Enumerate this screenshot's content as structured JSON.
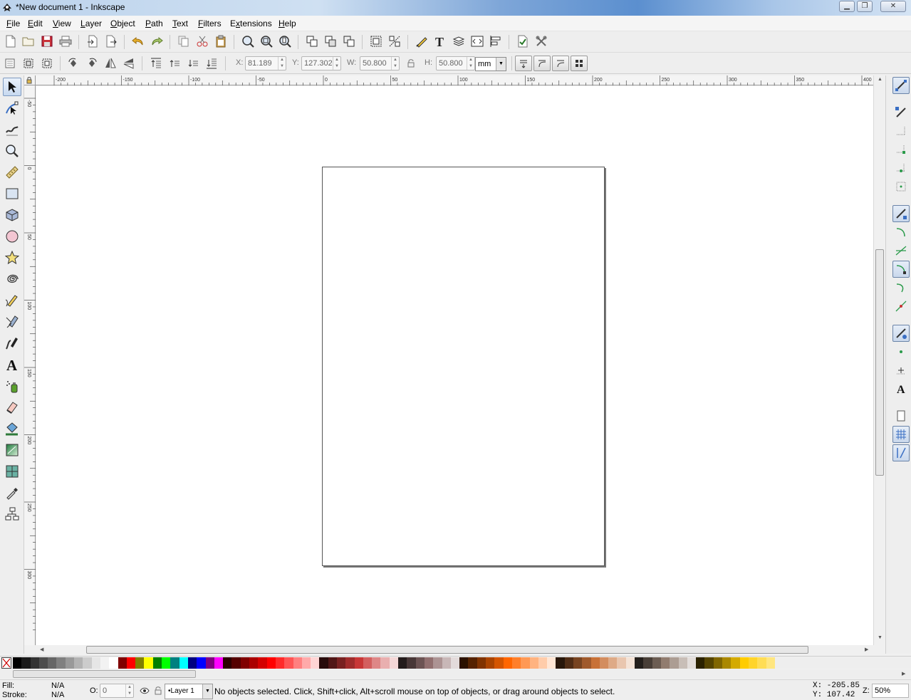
{
  "window": {
    "title": "*New document 1 - Inkscape"
  },
  "menu": [
    {
      "label": "File",
      "u": "F",
      "rest": "ile"
    },
    {
      "label": "Edit",
      "u": "E",
      "rest": "dit"
    },
    {
      "label": "View",
      "u": "V",
      "rest": "iew"
    },
    {
      "label": "Layer",
      "u": "L",
      "rest": "ayer"
    },
    {
      "label": "Object",
      "u": "O",
      "rest": "bject"
    },
    {
      "label": "Path",
      "u": "P",
      "rest": "ath"
    },
    {
      "label": "Text",
      "u": "T",
      "rest": "ext"
    },
    {
      "label": "Filters",
      "u": "F",
      "rest": "ilters"
    },
    {
      "label": "Extensions",
      "u": "x",
      "pre": "E",
      "rest": "tensions"
    },
    {
      "label": "Help",
      "u": "H",
      "rest": "elp"
    }
  ],
  "controls": {
    "x_label": "X:",
    "x_value": "81.189",
    "y_label": "Y:",
    "y_value": "127.302",
    "w_label": "W:",
    "w_value": "50.800",
    "h_label": "H:",
    "h_value": "50.800",
    "unit": "mm"
  },
  "ruler": {
    "h_labels": [
      "-200",
      "-150",
      "-100",
      "-50",
      "0",
      "50",
      "100",
      "150",
      "200",
      "250",
      "300",
      "350",
      "400"
    ],
    "v_labels": [
      "-50",
      "0",
      "50",
      "100",
      "150",
      "200",
      "250",
      "300"
    ]
  },
  "palette": {
    "colors": [
      "#000000",
      "#1a1a1a",
      "#333333",
      "#4d4d4d",
      "#666666",
      "#808080",
      "#999999",
      "#b3b3b3",
      "#cccccc",
      "#e6e6e6",
      "#f2f2f2",
      "#ffffff",
      "#800000",
      "#ff0000",
      "#808000",
      "#ffff00",
      "#008000",
      "#00ff00",
      "#008080",
      "#00ffff",
      "#000080",
      "#0000ff",
      "#800080",
      "#ff00ff",
      "#2b0000",
      "#550000",
      "#800000",
      "#aa0000",
      "#d40000",
      "#ff0000",
      "#ff2a2a",
      "#ff5555",
      "#ff8080",
      "#ffaaaa",
      "#ffd5d5",
      "#280b0b",
      "#501616",
      "#782121",
      "#a02c2c",
      "#c83737",
      "#d35f5f",
      "#de8787",
      "#e9afaf",
      "#f4d7d7",
      "#241c1c",
      "#483737",
      "#6c5353",
      "#916f6f",
      "#ac9393",
      "#c8b7b7",
      "#e3dbdb",
      "#2b1100",
      "#552200",
      "#803300",
      "#aa4400",
      "#d45500",
      "#ff6600",
      "#ff7f2a",
      "#ff9955",
      "#ffb380",
      "#ffccaa",
      "#ffe6d5",
      "#28170b",
      "#502d16",
      "#784421",
      "#a05a2c",
      "#c87137",
      "#d38d5f",
      "#deaa87",
      "#e9c6af",
      "#f4e3d7",
      "#241f1c",
      "#483e37",
      "#6c5d53",
      "#917c6f",
      "#ac9d93",
      "#c8beb7",
      "#e3dedb",
      "#2b2200",
      "#554400",
      "#806600",
      "#aa8800",
      "#d4aa00",
      "#ffcc00",
      "#ffd42a",
      "#ffdd55",
      "#ffe680"
    ]
  },
  "status": {
    "fill_label": "Fill:",
    "fill_value": "N/A",
    "stroke_label": "Stroke:",
    "stroke_value": "N/A",
    "opacity_label": "O:",
    "opacity_value": "0",
    "layer": "•Layer 1",
    "message": "No objects selected. Click, Shift+click, Alt+scroll mouse on top of objects, or drag around objects to select.",
    "x_coord": "X: -205.85",
    "y_coord": "Y:  107.42",
    "zoom_label": "Z:",
    "zoom_value": "50%"
  },
  "icons": {
    "tools": [
      "selector-icon",
      "node-icon",
      "tweak-icon",
      "zoom-icon",
      "measure-icon",
      "rectangle-icon",
      "box3d-icon",
      "ellipse-icon",
      "star-icon",
      "spiral-icon",
      "pencil-icon",
      "pen-icon",
      "calligraphy-icon",
      "text-icon",
      "spray-icon",
      "eraser-icon",
      "paint-bucket-icon",
      "gradient-icon",
      "mesh-icon",
      "dropper-icon",
      "connector-icon"
    ]
  }
}
